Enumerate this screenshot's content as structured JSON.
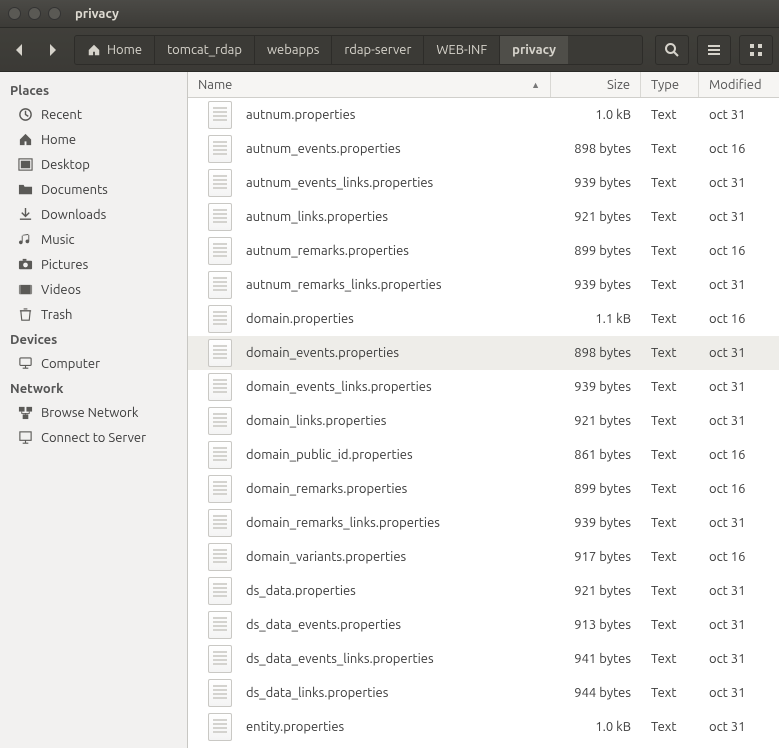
{
  "titlebar": {
    "title": "privacy"
  },
  "breadcrumb": [
    {
      "label": "Home",
      "home": true
    },
    {
      "label": "tomcat_rdap"
    },
    {
      "label": "webapps"
    },
    {
      "label": "rdap-server"
    },
    {
      "label": "WEB-INF"
    },
    {
      "label": "privacy",
      "active": true
    }
  ],
  "sidebar": {
    "groups": [
      {
        "header": "Places",
        "items": [
          {
            "label": "Recent",
            "icon": "clock"
          },
          {
            "label": "Home",
            "icon": "home"
          },
          {
            "label": "Desktop",
            "icon": "desktop"
          },
          {
            "label": "Documents",
            "icon": "folder"
          },
          {
            "label": "Downloads",
            "icon": "download"
          },
          {
            "label": "Music",
            "icon": "music"
          },
          {
            "label": "Pictures",
            "icon": "camera"
          },
          {
            "label": "Videos",
            "icon": "video"
          },
          {
            "label": "Trash",
            "icon": "trash"
          }
        ]
      },
      {
        "header": "Devices",
        "items": [
          {
            "label": "Computer",
            "icon": "computer"
          }
        ]
      },
      {
        "header": "Network",
        "items": [
          {
            "label": "Browse Network",
            "icon": "network"
          },
          {
            "label": "Connect to Server",
            "icon": "server"
          }
        ]
      }
    ]
  },
  "columns": {
    "name": "Name",
    "size": "Size",
    "type": "Type",
    "modified": "Modified"
  },
  "files": [
    {
      "name": "autnum.properties",
      "size": "1.0 kB",
      "type": "Text",
      "modified": "oct 31"
    },
    {
      "name": "autnum_events.properties",
      "size": "898 bytes",
      "type": "Text",
      "modified": "oct 16"
    },
    {
      "name": "autnum_events_links.properties",
      "size": "939 bytes",
      "type": "Text",
      "modified": "oct 31"
    },
    {
      "name": "autnum_links.properties",
      "size": "921 bytes",
      "type": "Text",
      "modified": "oct 31"
    },
    {
      "name": "autnum_remarks.properties",
      "size": "899 bytes",
      "type": "Text",
      "modified": "oct 16"
    },
    {
      "name": "autnum_remarks_links.properties",
      "size": "939 bytes",
      "type": "Text",
      "modified": "oct 31"
    },
    {
      "name": "domain.properties",
      "size": "1.1 kB",
      "type": "Text",
      "modified": "oct 16"
    },
    {
      "name": "domain_events.properties",
      "size": "898 bytes",
      "type": "Text",
      "modified": "oct 31",
      "selected": true
    },
    {
      "name": "domain_events_links.properties",
      "size": "939 bytes",
      "type": "Text",
      "modified": "oct 31"
    },
    {
      "name": "domain_links.properties",
      "size": "921 bytes",
      "type": "Text",
      "modified": "oct 31"
    },
    {
      "name": "domain_public_id.properties",
      "size": "861 bytes",
      "type": "Text",
      "modified": "oct 16"
    },
    {
      "name": "domain_remarks.properties",
      "size": "899 bytes",
      "type": "Text",
      "modified": "oct 16"
    },
    {
      "name": "domain_remarks_links.properties",
      "size": "939 bytes",
      "type": "Text",
      "modified": "oct 31"
    },
    {
      "name": "domain_variants.properties",
      "size": "917 bytes",
      "type": "Text",
      "modified": "oct 16"
    },
    {
      "name": "ds_data.properties",
      "size": "921 bytes",
      "type": "Text",
      "modified": "oct 31"
    },
    {
      "name": "ds_data_events.properties",
      "size": "913 bytes",
      "type": "Text",
      "modified": "oct 31"
    },
    {
      "name": "ds_data_events_links.properties",
      "size": "941 bytes",
      "type": "Text",
      "modified": "oct 31"
    },
    {
      "name": "ds_data_links.properties",
      "size": "944 bytes",
      "type": "Text",
      "modified": "oct 31"
    },
    {
      "name": "entity.properties",
      "size": "1.0 kB",
      "type": "Text",
      "modified": "oct 31"
    }
  ]
}
